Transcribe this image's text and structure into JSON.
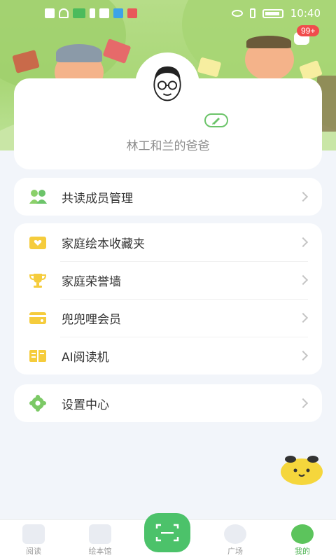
{
  "status_bar": {
    "time": "10:40",
    "left_icons": [
      "warning-icon",
      "wifi-icon",
      "app-icon",
      "usb-icon",
      "mail-icon",
      "search-app-icon",
      "book-app-icon"
    ],
    "right_icons": [
      "eye-icon",
      "vibrate-icon",
      "battery-icon"
    ]
  },
  "header": {
    "message_badge": "99+"
  },
  "profile": {
    "nickname": "~",
    "role": "林工和兰的爸爸"
  },
  "menu_groups": [
    {
      "items": [
        {
          "label": "共读成员管理",
          "icon": "members-icon"
        }
      ]
    },
    {
      "items": [
        {
          "label": "家庭绘本收藏夹",
          "icon": "folder-heart-icon"
        },
        {
          "label": "家庭荣誉墙",
          "icon": "trophy-icon"
        },
        {
          "label": "兜兜哩会员",
          "icon": "membership-card-icon"
        },
        {
          "label": "AI阅读机",
          "icon": "reader-icon"
        }
      ]
    },
    {
      "items": [
        {
          "label": "设置中心",
          "icon": "settings-gear-icon"
        }
      ]
    }
  ],
  "bottom_nav": {
    "items": [
      {
        "label": "阅读",
        "icon": "book-icon"
      },
      {
        "label": "绘本馆",
        "icon": "library-icon"
      },
      {
        "label": "",
        "icon": "scan-icon"
      },
      {
        "label": "广场",
        "icon": "planet-icon"
      },
      {
        "label": "我的",
        "icon": "mascot-icon"
      }
    ],
    "active_index": 4
  },
  "colors": {
    "accent": "#4cc26a",
    "badge": "#f04c4c",
    "background": "#f2f5fa",
    "icon_yellow": "#f5cc3c"
  }
}
